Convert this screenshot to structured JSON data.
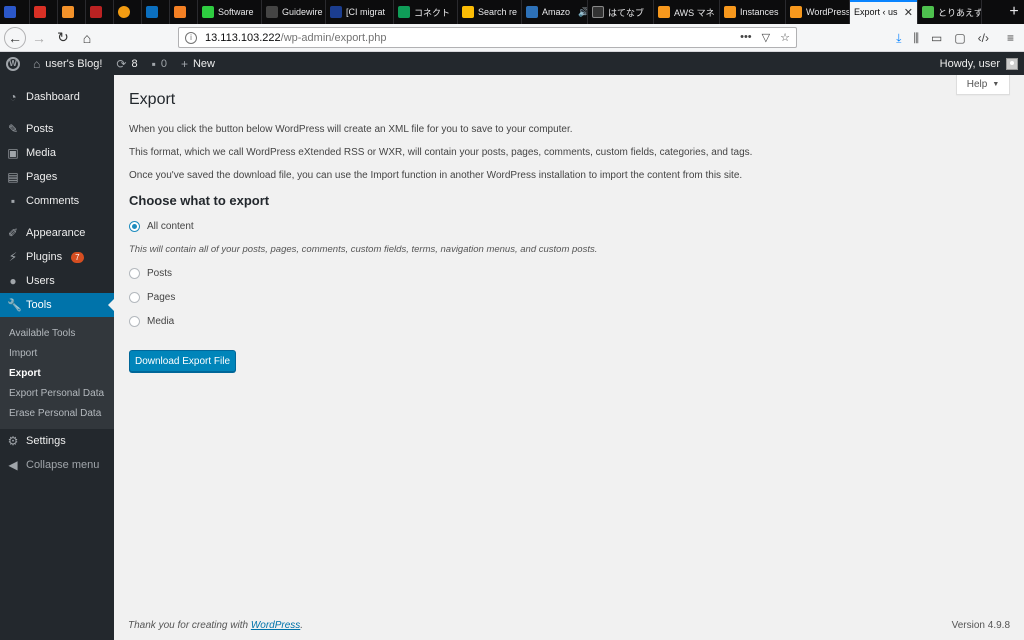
{
  "browser": {
    "tabs": [
      {
        "label": "",
        "color": "#2b57c9"
      },
      {
        "label": "",
        "color": "#d93025"
      },
      {
        "label": "",
        "color": "#f3922a"
      },
      {
        "label": "",
        "color": "#b22"
      },
      {
        "label": "",
        "color": "#f39c12"
      },
      {
        "label": "",
        "color": "#0b6fbf"
      },
      {
        "label": "",
        "color": "#f48024"
      },
      {
        "label": "Software",
        "color": "#2ecc40"
      },
      {
        "label": "Guidewire",
        "color": "#222"
      },
      {
        "label": "[CI migrat",
        "color": "#1b3d8f"
      },
      {
        "label": "コネクト",
        "color": "#0f9d58"
      },
      {
        "label": "Search re",
        "color": "#fbbc05"
      },
      {
        "label": "Amazo",
        "color": "#2d71b8"
      },
      {
        "label": "はてなブ",
        "color": "#333"
      },
      {
        "label": "AWS マネ",
        "color": "#f7981d"
      },
      {
        "label": "Instances",
        "color": "#f7981d"
      },
      {
        "label": "WordPress",
        "color": "#f7981d"
      },
      {
        "label": "Export ‹ us",
        "color": "",
        "active": true
      },
      {
        "label": "とりあえず",
        "color": "#4ec14e"
      }
    ],
    "url_host": "13.113.103.222",
    "url_path": "/wp-admin/export.php"
  },
  "adminbar": {
    "site_name": "user's Blog!",
    "updates_count": "8",
    "comments_count": "0",
    "new_label": "New",
    "howdy": "Howdy, user"
  },
  "sidebar": {
    "items": [
      {
        "label": "Dashboard",
        "icon": "dashboard-icon"
      },
      {
        "label": "Posts",
        "icon": "pin-icon"
      },
      {
        "label": "Media",
        "icon": "media-icon"
      },
      {
        "label": "Pages",
        "icon": "pages-icon"
      },
      {
        "label": "Comments",
        "icon": "comments-icon"
      },
      {
        "label": "Appearance",
        "icon": "brush-icon"
      },
      {
        "label": "Plugins",
        "icon": "plugin-icon",
        "badge": "7"
      },
      {
        "label": "Users",
        "icon": "users-icon"
      },
      {
        "label": "Tools",
        "icon": "wrench-icon",
        "current": true
      },
      {
        "label": "Settings",
        "icon": "settings-icon"
      },
      {
        "label": "Collapse menu",
        "icon": "collapse-icon"
      }
    ],
    "tools_submenu": [
      "Available Tools",
      "Import",
      "Export",
      "Export Personal Data",
      "Erase Personal Data"
    ]
  },
  "main": {
    "help_label": "Help",
    "title": "Export",
    "intro_1": "When you click the button below WordPress will create an XML file for you to save to your computer.",
    "intro_2": "This format, which we call WordPress eXtended RSS or WXR, will contain your posts, pages, comments, custom fields, categories, and tags.",
    "intro_3": "Once you've saved the download file, you can use the Import function in another WordPress installation to import the content from this site.",
    "choose_title": "Choose what to export",
    "options": [
      "All content",
      "Posts",
      "Pages",
      "Media"
    ],
    "selected_option": "All content",
    "all_content_desc": "This will contain all of your posts, pages, comments, custom fields, terms, navigation menus, and custom posts.",
    "download_button": "Download Export File"
  },
  "footer": {
    "thanks_prefix": "Thank you for creating with ",
    "thanks_link": "WordPress",
    "thanks_suffix": ".",
    "version": "Version 4.9.8"
  },
  "colors": {
    "admin_dark": "#23282d",
    "primary": "#0085ba",
    "current_menu": "#0073aa"
  }
}
